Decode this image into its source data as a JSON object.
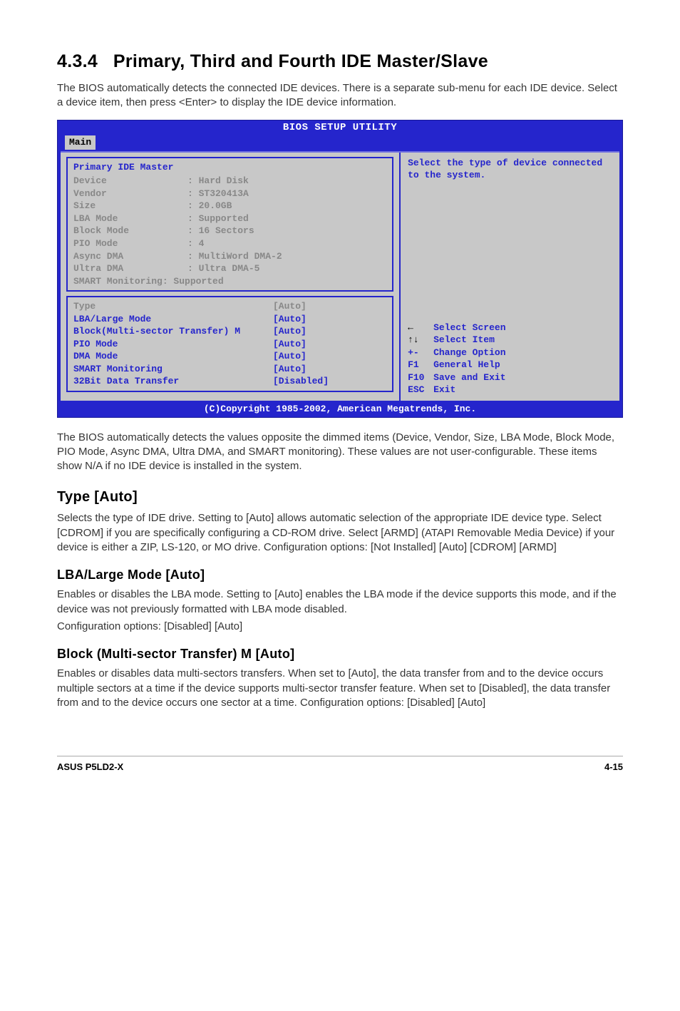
{
  "section": {
    "number": "4.3.4",
    "title": "Primary, Third and Fourth IDE Master/Slave",
    "intro": "The BIOS automatically detects the connected IDE devices. There is a separate sub-menu for each IDE device. Select a device item, then press <Enter> to display the IDE device information."
  },
  "bios": {
    "title": "BIOS SETUP UTILITY",
    "tab": "Main",
    "panel_title": "Primary IDE Master",
    "info": [
      {
        "label": "Device",
        "value": ": Hard Disk"
      },
      {
        "label": "Vendor",
        "value": ": ST320413A"
      },
      {
        "label": "Size",
        "value": ": 20.0GB"
      },
      {
        "label": "LBA Mode",
        "value": ": Supported"
      },
      {
        "label": "Block Mode",
        "value": ": 16 Sectors"
      },
      {
        "label": "PIO Mode",
        "value": ": 4"
      },
      {
        "label": "Async DMA",
        "value": ": MultiWord DMA-2"
      },
      {
        "label": "Ultra DMA",
        "value": ": Ultra DMA-5"
      },
      {
        "label": "SMART Monitoring",
        "value": ": Supported"
      }
    ],
    "settings": [
      {
        "label": "Type",
        "value": "[Auto]",
        "dim": true
      },
      {
        "label": "LBA/Large Mode",
        "value": "[Auto]",
        "dim": false
      },
      {
        "label": "Block(Multi-sector Transfer) M",
        "value": "[Auto]",
        "dim": false
      },
      {
        "label": "PIO Mode",
        "value": "[Auto]",
        "dim": false
      },
      {
        "label": "DMA Mode",
        "value": "[Auto]",
        "dim": false
      },
      {
        "label": "SMART Monitoring",
        "value": "[Auto]",
        "dim": false
      },
      {
        "label": "32Bit Data Transfer",
        "value": "[Disabled]",
        "dim": false
      }
    ],
    "help": "Select the type of device connected to the system.",
    "keys": [
      {
        "key": "←",
        "action": "Select Screen"
      },
      {
        "key": "↑↓",
        "action": "Select Item"
      },
      {
        "key": "+-",
        "action": "Change Option"
      },
      {
        "key": "F1",
        "action": "General Help"
      },
      {
        "key": "F10",
        "action": "Save and Exit"
      },
      {
        "key": "ESC",
        "action": "Exit"
      }
    ],
    "footer": "(C)Copyright 1985-2002, American Megatrends, Inc."
  },
  "para_after": "The BIOS automatically detects the values opposite the dimmed items (Device, Vendor, Size, LBA Mode, Block Mode, PIO Mode, Async DMA, Ultra DMA, and SMART monitoring). These values are not user-configurable. These items show N/A if no IDE device is installed in the system.",
  "type_section": {
    "heading": "Type [Auto]",
    "body": "Selects the type of IDE drive. Setting to [Auto] allows automatic selection of the appropriate IDE device type. Select [CDROM] if you are specifically configuring a CD-ROM drive. Select [ARMD] (ATAPI Removable Media Device) if your device is either a ZIP, LS-120, or MO drive. Configuration options: [Not Installed] [Auto] [CDROM] [ARMD]"
  },
  "lba_section": {
    "heading": "LBA/Large Mode [Auto]",
    "body1": "Enables or disables the LBA mode. Setting to [Auto] enables the LBA mode if the device supports this mode, and if the device was not previously formatted with LBA mode disabled.",
    "body2": "Configuration options: [Disabled] [Auto]"
  },
  "block_section": {
    "heading": "Block (Multi-sector Transfer) M [Auto]",
    "body": "Enables or disables data multi-sectors transfers. When set to [Auto], the data transfer from and to the device occurs multiple sectors at a time if the device supports multi-sector transfer feature. When set to [Disabled], the data transfer from and to the device occurs one sector at a time. Configuration options: [Disabled] [Auto]"
  },
  "footer": {
    "left": "ASUS P5LD2-X",
    "right": "4-15"
  }
}
